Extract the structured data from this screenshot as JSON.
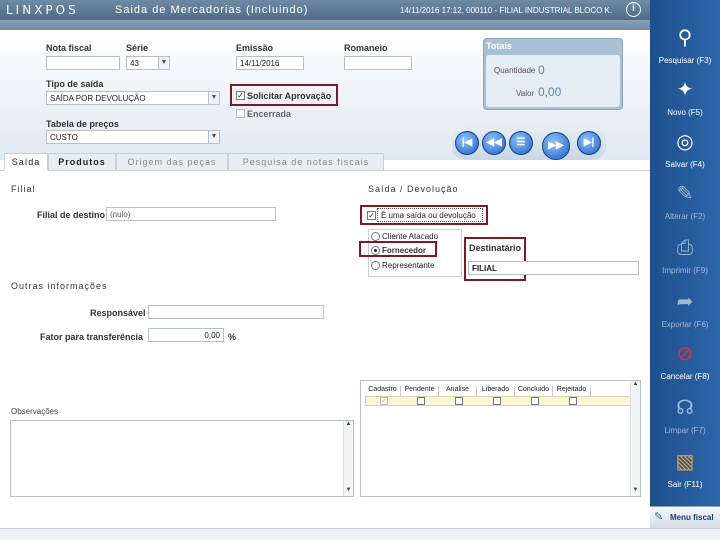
{
  "window": {
    "brand": "LINXPOS",
    "title": "Saida de Mercadorias (Incluindo)",
    "info": "14/11/2016 17:12, 000110 - FILIAL INDUSTRIAL BLOCO K."
  },
  "header": {
    "nota_fiscal_label": "Nota fiscal",
    "nota_fiscal_value": "",
    "serie_label": "Série",
    "serie_value": "43",
    "emissao_label": "Emissão",
    "emissao_value": "14/11/2016",
    "romaneio_label": "Romaneio",
    "romaneio_value": "",
    "tipo_saida_label": "Tipo de saída",
    "tipo_saida_value": "SAÍDA POR DEVOLUÇÃO",
    "solicitar_aprovacao_label": "Solicitar Aprovação",
    "solicitar_aprovacao_checked": true,
    "encerrada_label": "Encerrada",
    "encerrada_checked": false,
    "tabela_precos_label": "Tabela de preços",
    "tabela_precos_value": "CUSTO"
  },
  "totals": {
    "title": "Totais",
    "quantidade_label": "Quantidade",
    "quantidade_value": "0",
    "valor_label": "Valor",
    "valor_value": "0,00"
  },
  "nav": {
    "first": "|◀",
    "prev": "◀◀",
    "list": "☰",
    "next": "▶▶",
    "last": "▶|"
  },
  "tabs": [
    {
      "label": "Saída"
    },
    {
      "label": "Produtos"
    },
    {
      "label": "Origem das peças"
    },
    {
      "label": "Pesquisa de notas fiscais"
    }
  ],
  "filial": {
    "section_title": "Filial",
    "destino_label": "Filial de destino",
    "destino_value": "(nulo)"
  },
  "saida": {
    "section_title": "Saída / Devolução",
    "devolucao_label": "É uma saída ou devolução",
    "devolucao_checked": true,
    "options": [
      "Cliente Atacado",
      "Fornecedor",
      "Representante"
    ],
    "selected": "Fornecedor",
    "destinatario_label": "Destinatário",
    "destinatario_value": "FILIAL"
  },
  "outras": {
    "section_title": "Outras informações",
    "responsavel_label": "Responsável",
    "responsavel_value": "",
    "fator_label": "Fator para transferência",
    "fator_value": "0,00",
    "fator_unit": "%"
  },
  "observacoes_label": "Observações",
  "grid": {
    "headers": [
      "Cadastro",
      "Pendente",
      "Analise",
      "Liberado",
      "Concluido",
      "Rejeitado"
    ]
  },
  "sidebar": {
    "items": [
      {
        "label": "Pesquisar (F3)",
        "icon": "search-icon"
      },
      {
        "label": "Novo (F5)",
        "icon": "new-document-icon"
      },
      {
        "label": "Salvar (F4)",
        "icon": "save-disc-icon"
      },
      {
        "label": "Alterar (F2)",
        "icon": "edit-pen-icon"
      },
      {
        "label": "Imprimir (F9)",
        "icon": "printer-icon"
      },
      {
        "label": "Exportar (F6)",
        "icon": "export-icon"
      },
      {
        "label": "Cancelar (F8)",
        "icon": "cancel-icon"
      },
      {
        "label": "Limpar (F7)",
        "icon": "broom-icon"
      },
      {
        "label": "Sair (F11)",
        "icon": "exit-door-icon"
      }
    ],
    "menu_fiscal_label": "Menu fiscal"
  },
  "colors": {
    "accent": "#2c66aa",
    "highlight_border": "#7a1b22",
    "totals_value": "#5b86b5"
  }
}
